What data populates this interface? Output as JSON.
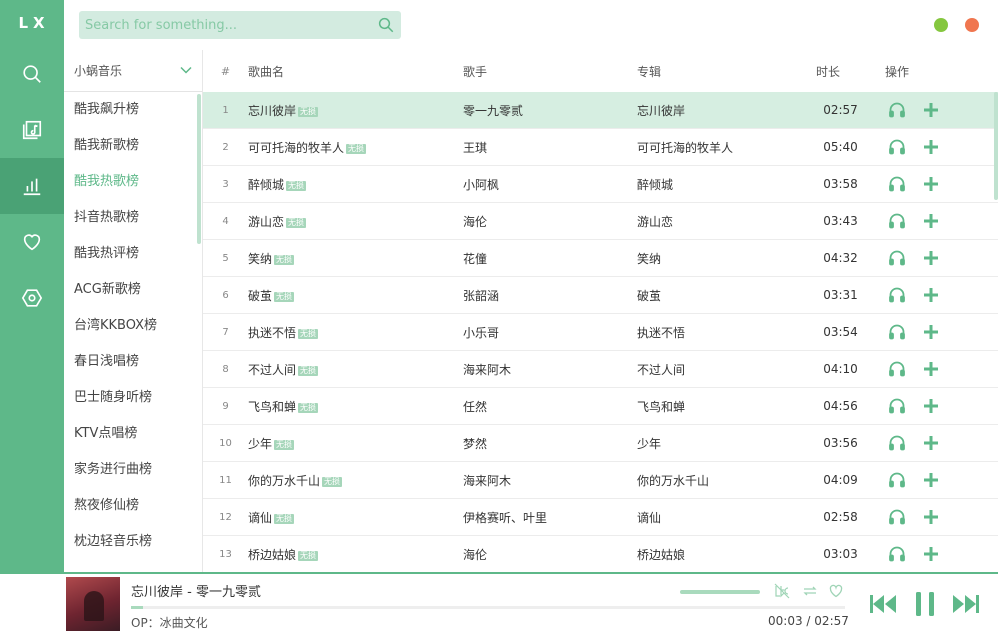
{
  "app": {
    "logo": "LX"
  },
  "nav": [
    {
      "name": "search",
      "icon": "search-icon",
      "active": false
    },
    {
      "name": "songlist",
      "icon": "music-library-icon",
      "active": false
    },
    {
      "name": "leaderboard",
      "icon": "bar-chart-icon",
      "active": true
    },
    {
      "name": "favorites",
      "icon": "heart-icon",
      "active": false
    },
    {
      "name": "settings",
      "icon": "settings-hex-icon",
      "active": false
    }
  ],
  "header": {
    "search_placeholder": "Search for something...",
    "min_color": "#85c73f",
    "close_color": "#f0764f"
  },
  "source": {
    "selected": "小蜗音乐",
    "items": [
      "酷我飙升榜",
      "酷我新歌榜",
      "酷我热歌榜",
      "抖音热歌榜",
      "酷我热评榜",
      "ACG新歌榜",
      "台湾KKBOX榜",
      "春日浅唱榜",
      "巴士随身听榜",
      "KTV点唱榜",
      "家务进行曲榜",
      "熬夜修仙榜",
      "枕边轻音乐榜"
    ],
    "active_index": 2
  },
  "table": {
    "headers": {
      "idx": "#",
      "name": "歌曲名",
      "singer": "歌手",
      "album": "专辑",
      "duration": "时长",
      "ops": "操作"
    },
    "badge": "无损",
    "active_row": 0,
    "rows": [
      {
        "idx": "1",
        "name": "忘川彼岸",
        "singer": "零一九零贰",
        "album": "忘川彼岸",
        "duration": "02:57"
      },
      {
        "idx": "2",
        "name": "可可托海的牧羊人",
        "singer": "王琪",
        "album": "可可托海的牧羊人",
        "duration": "05:40"
      },
      {
        "idx": "3",
        "name": "醉倾城",
        "singer": "小阿枫",
        "album": "醉倾城",
        "duration": "03:58"
      },
      {
        "idx": "4",
        "name": "游山恋",
        "singer": "海伦",
        "album": "游山恋",
        "duration": "03:43"
      },
      {
        "idx": "5",
        "name": "笑纳",
        "singer": "花僮",
        "album": "笑纳",
        "duration": "04:32"
      },
      {
        "idx": "6",
        "name": "破茧",
        "singer": "张韶涵",
        "album": "破茧",
        "duration": "03:31"
      },
      {
        "idx": "7",
        "name": "执迷不悟",
        "singer": "小乐哥",
        "album": "执迷不悟",
        "duration": "03:54"
      },
      {
        "idx": "8",
        "name": "不过人间",
        "singer": "海来阿木",
        "album": "不过人间",
        "duration": "04:10"
      },
      {
        "idx": "9",
        "name": "飞鸟和蝉",
        "singer": "任然",
        "album": "飞鸟和蝉",
        "duration": "04:56"
      },
      {
        "idx": "10",
        "name": "少年",
        "singer": "梦然",
        "album": "少年",
        "duration": "03:56"
      },
      {
        "idx": "11",
        "name": "你的万水千山",
        "singer": "海来阿木",
        "album": "你的万水千山",
        "duration": "04:09"
      },
      {
        "idx": "12",
        "name": "谪仙",
        "singer": "伊格赛听、叶里",
        "album": "谪仙",
        "duration": "02:58"
      },
      {
        "idx": "13",
        "name": "桥边姑娘",
        "singer": "海伦",
        "album": "桥边姑娘",
        "duration": "03:03"
      }
    ]
  },
  "player": {
    "title": "忘川彼岸 - 零一九零贰",
    "info": "OP：冰曲文化",
    "current_time": "00:03",
    "separator": "/",
    "total_time": "02:57",
    "progress": 0.017,
    "accent": "#5eb889"
  }
}
